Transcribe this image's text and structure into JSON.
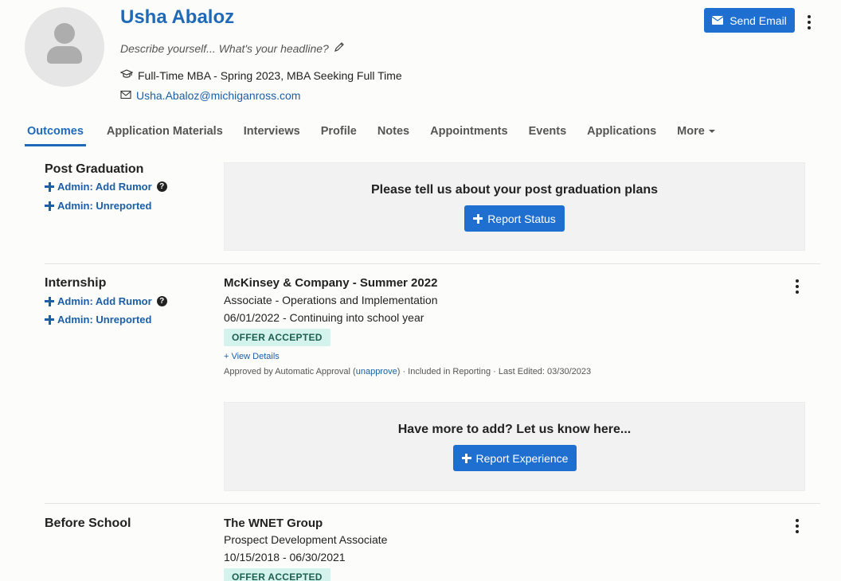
{
  "profile": {
    "name": "Usha Abaloz",
    "headline_placeholder": "Describe yourself... What's your headline?",
    "program": "Full-Time MBA - Spring 2023, MBA Seeking Full Time",
    "email": "Usha.Abaloz@michiganross.com",
    "send_email_label": "Send Email"
  },
  "tabs": [
    {
      "label": "Outcomes",
      "active": true
    },
    {
      "label": "Application Materials"
    },
    {
      "label": "Interviews"
    },
    {
      "label": "Profile"
    },
    {
      "label": "Notes"
    },
    {
      "label": "Appointments"
    },
    {
      "label": "Events"
    },
    {
      "label": "Applications"
    },
    {
      "label": "More"
    }
  ],
  "admin_links": {
    "add_rumor": "Admin: Add Rumor",
    "unreported": "Admin: Unreported"
  },
  "sections": {
    "post_graduation": {
      "title": "Post Graduation",
      "prompt": "Please tell us about your post graduation plans",
      "button": "Report Status"
    },
    "internship": {
      "title": "Internship",
      "experience": {
        "title": "McKinsey & Company - Summer 2022",
        "role": "Associate - Operations and Implementation",
        "dates": "06/01/2022 - Continuing into school year",
        "status": "OFFER ACCEPTED",
        "view_details": "+ View Details",
        "meta_prefix": "Approved by Automatic Approval (",
        "meta_link": "unapprove",
        "meta_suffix": ") · Included in Reporting · Last Edited: 03/30/2023"
      },
      "prompt": "Have more to add? Let us know here...",
      "button": "Report Experience"
    },
    "before_school": {
      "title": "Before School",
      "experience": {
        "title": "The WNET Group",
        "role": "Prospect Development Associate",
        "dates": "10/15/2018 - 06/30/2021",
        "status": "OFFER ACCEPTED"
      }
    }
  },
  "colors": {
    "primary": "#1f6fd1",
    "name": "#1f6ab8",
    "link": "#1a5fa8",
    "badge_bg": "#d3f3ec",
    "badge_text": "#1d5f50"
  },
  "icons": {
    "avatar": "user-silhouette-icon",
    "headline_edit": "pencil-icon",
    "program": "graduation-cap-icon",
    "email": "envelope-icon",
    "send_email": "envelope-icon",
    "menu": "kebab-menu-icon",
    "add": "plus-icon",
    "help": "question-circle-icon",
    "dropdown": "caret-down-icon"
  }
}
